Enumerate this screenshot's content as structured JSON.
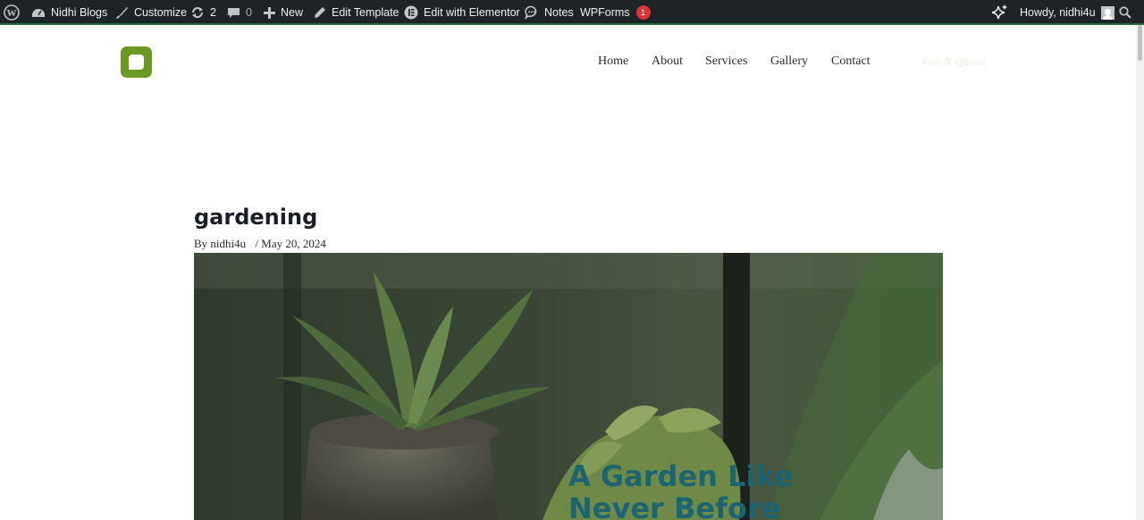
{
  "admin_bar": {
    "site_name": "Nidhi  Blogs",
    "customize": "Customize",
    "updates_count": "2",
    "comments_count": "0",
    "new": "New",
    "edit_template": "Edit  Template",
    "edit_elementor": "Edit  with  Elementor",
    "notes": "Notes",
    "wpforms": "WPForms",
    "wpforms_badge": "1",
    "howdy": "Howdy,  nidhi4u"
  },
  "site_header": {
    "brand_color": "#6a9a24",
    "nav": [
      "Home",
      "About",
      "Services",
      "Gallery",
      "Contact"
    ],
    "cta": "Get  A  Quote"
  },
  "post": {
    "title": "gardening",
    "author_prefix": "By",
    "author": "nidhi4u",
    "date": "/ May 20, 2024",
    "hero_heading": "A Garden Like Never Before",
    "hero_heading_color": "#1d6472"
  }
}
